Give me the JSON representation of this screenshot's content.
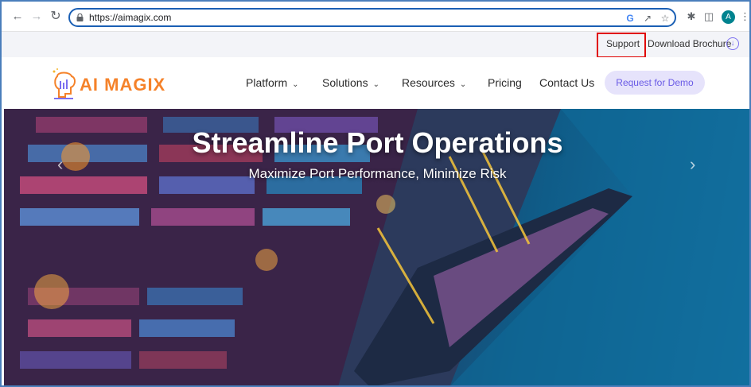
{
  "browser": {
    "url": "https://aimagix.com",
    "profile_initial": "A",
    "icons": [
      "back-arrow-icon",
      "forward-arrow-icon",
      "reload-icon",
      "lock-icon",
      "google-icon",
      "share-icon",
      "star-icon",
      "extensions-icon",
      "side-panel-icon",
      "menu-icon"
    ]
  },
  "utility": {
    "support": "Support",
    "brochure": "Download Brochure"
  },
  "site": {
    "logo": "AI MAGIX",
    "nav": [
      "Platform",
      "Solutions",
      "Resources",
      "Pricing",
      "Contact Us"
    ],
    "demo": "Request for Demo"
  },
  "hero": {
    "title": "Streamline Port Operations",
    "subtitle": "Maximize Port Performance, Minimize Risk"
  },
  "colors": {
    "accent": "#7b6ff0",
    "logo": "#f5822a",
    "highlight": "#e00000",
    "omnibox_border": "#1a5fb4"
  }
}
